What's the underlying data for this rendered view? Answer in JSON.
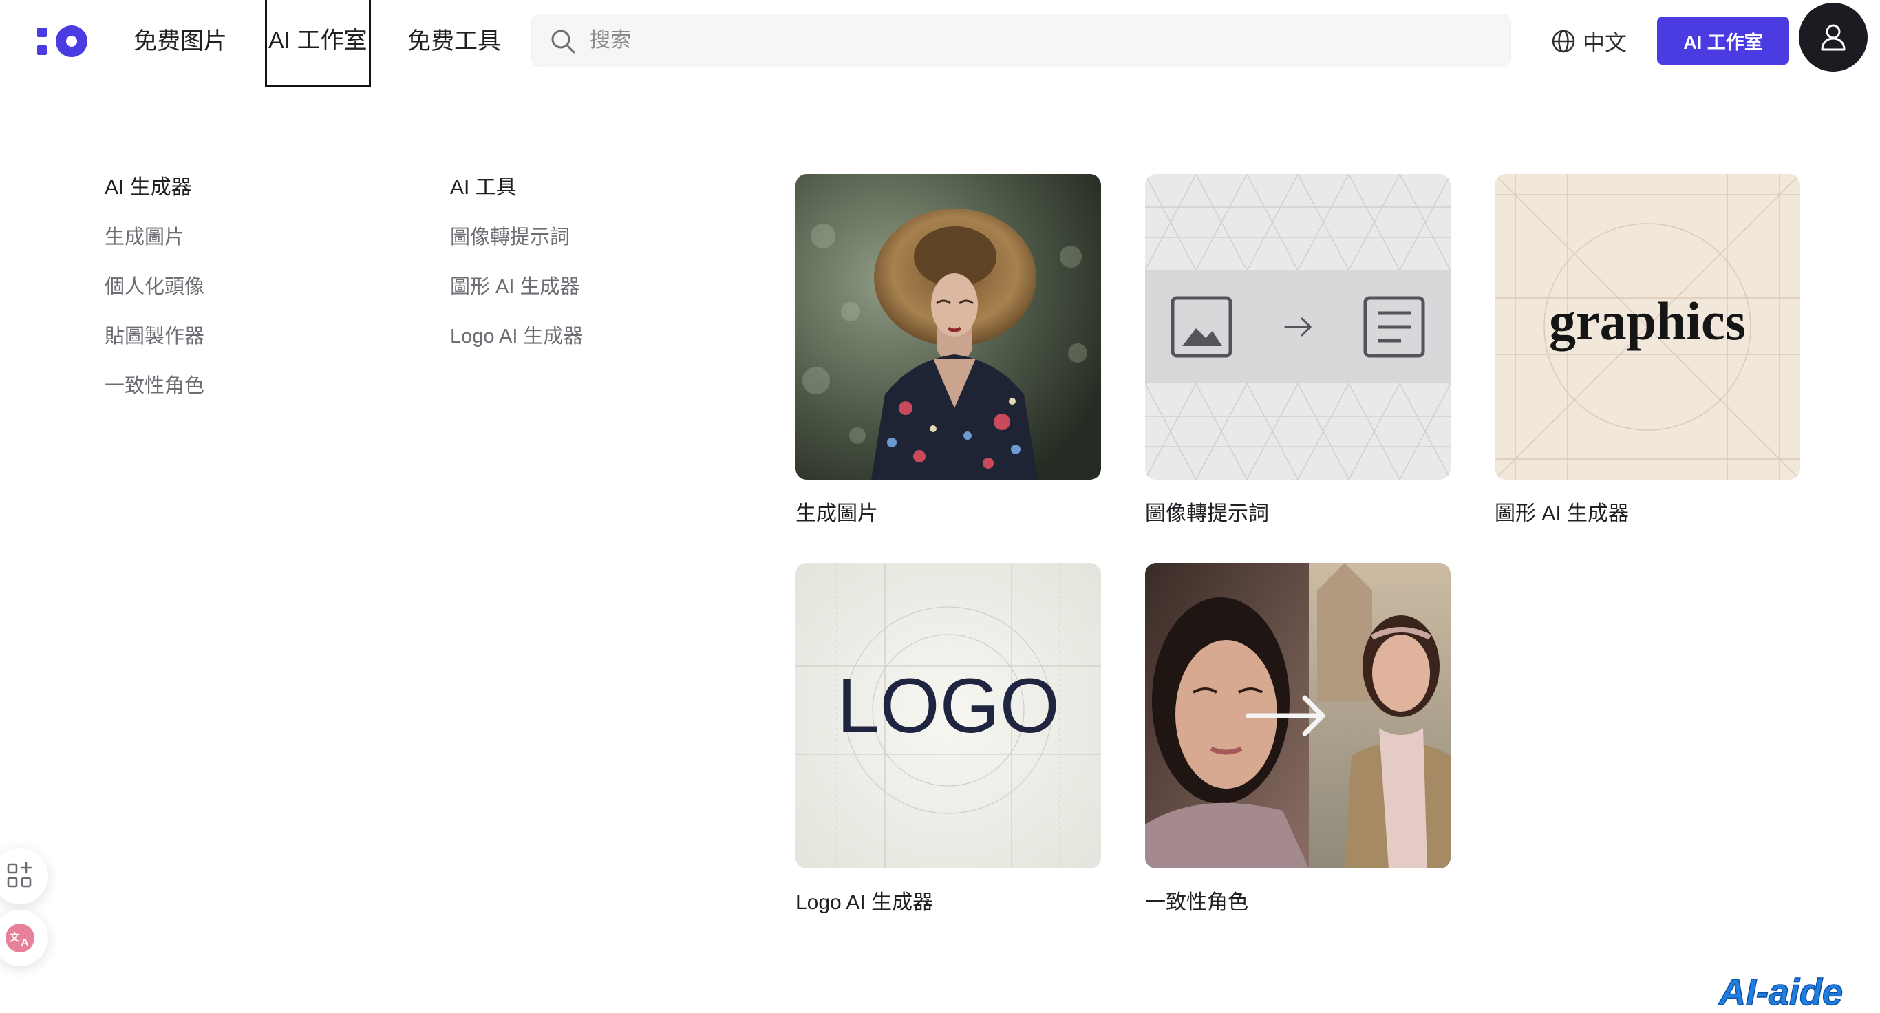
{
  "header": {
    "logo_icon": "brand-logo-icon",
    "nav": [
      {
        "label": "免费图片"
      },
      {
        "label": "AI 工作室"
      },
      {
        "label": "免费工具"
      }
    ],
    "search": {
      "placeholder": "搜索",
      "value": ""
    },
    "language": {
      "label": "中文",
      "icon": "globe-icon"
    },
    "studio_button": "AI 工作室",
    "avatar_icon": "user-icon"
  },
  "menu": {
    "generators": {
      "heading": "AI 生成器",
      "items": [
        "生成圖片",
        "個人化頭像",
        "貼圖製作器",
        "一致性角色"
      ]
    },
    "tools": {
      "heading": "AI 工具",
      "items": [
        "圖像轉提示詞",
        "圖形 AI 生成器",
        "Logo AI 生成器"
      ]
    }
  },
  "cards": [
    {
      "label": "生成圖片",
      "thumb": "fashion-portrait-image"
    },
    {
      "label": "圖像轉提示詞",
      "thumb": "image-to-text-illustration"
    },
    {
      "label": "圖形 AI 生成器",
      "thumb": "graphics-typography-image",
      "thumb_text": "graphics"
    },
    {
      "label": "Logo AI 生成器",
      "thumb": "logo-typography-image",
      "thumb_text": "LOGO"
    },
    {
      "label": "一致性角色",
      "thumb": "consistent-character-image"
    }
  ],
  "floating_tools": [
    "apps-grid-icon",
    "translate-icon"
  ],
  "watermark": {
    "text": "AI-aide"
  },
  "colors": {
    "brand": "#4a3ce0",
    "text": "#1f2024",
    "muted": "#6d6e74",
    "avatar_bg": "#1b1c22"
  }
}
